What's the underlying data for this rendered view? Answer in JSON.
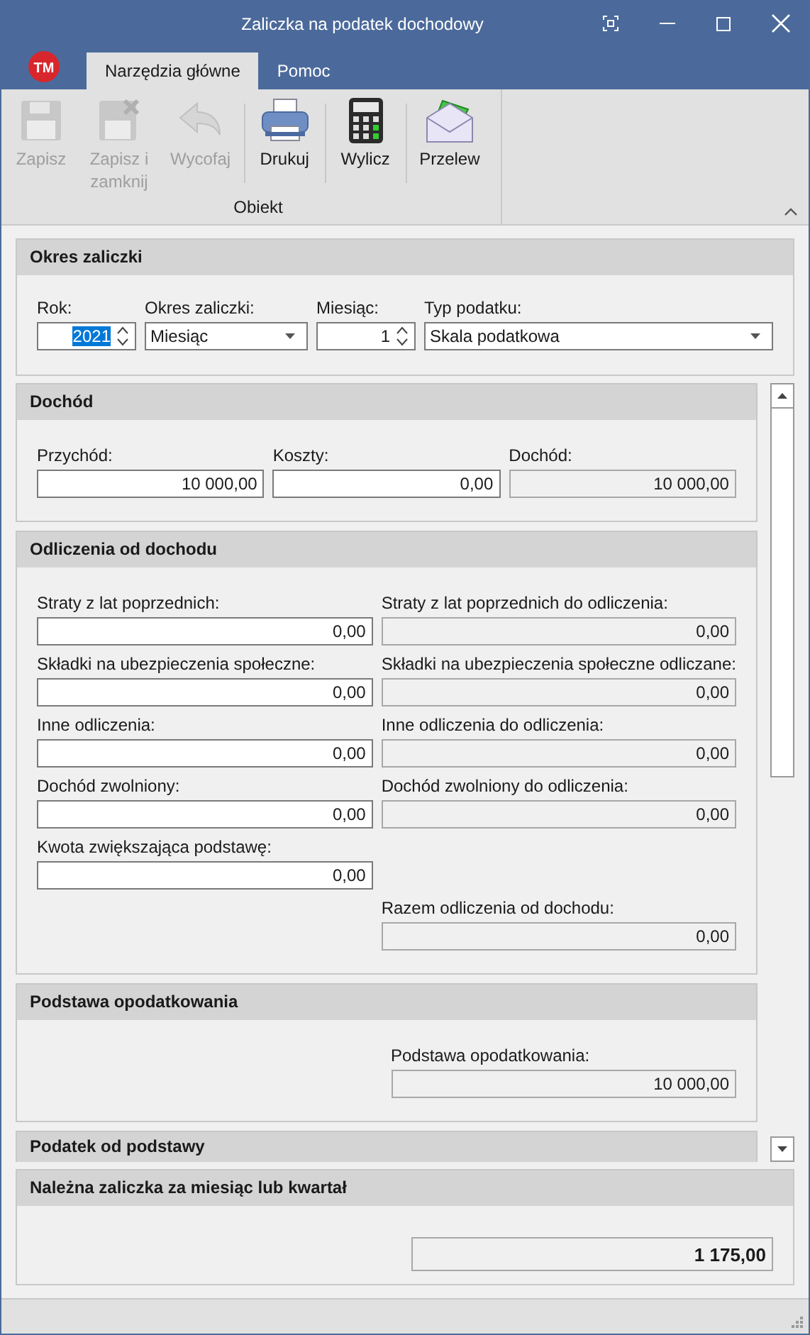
{
  "window": {
    "title": "Zaliczka na podatek dochodowy"
  },
  "ribbon": {
    "logo": "TM",
    "tabs": [
      {
        "label": "Narzędzia główne",
        "selected": true
      },
      {
        "label": "Pomoc",
        "selected": false
      }
    ],
    "buttons": [
      {
        "label": "Zapisz",
        "kind": "floppy",
        "disabled": true,
        "separated": false
      },
      {
        "label": "Zapisz i zamknij",
        "kind": "floppy-x",
        "disabled": true,
        "separated": false
      },
      {
        "label": "Wycofaj",
        "kind": "undo",
        "disabled": true,
        "separated": false
      },
      {
        "label": "Drukuj",
        "kind": "printer",
        "disabled": false,
        "separated": true
      },
      {
        "label": "Wylicz",
        "kind": "calculator",
        "disabled": false,
        "separated": true
      },
      {
        "label": "Przelew",
        "kind": "envelope",
        "disabled": false,
        "separated": true
      }
    ],
    "group": "Obiekt"
  },
  "sections": [
    {
      "title": "Okres zaliczki",
      "rows": [
        [
          {
            "label": "Rok:",
            "value": "2021",
            "kind": "spin",
            "selected": true
          },
          {
            "label": "Okres zaliczki:",
            "value": "Miesiąc",
            "kind": "combo",
            "selected": false
          },
          {
            "label": "Miesiąc:",
            "value": "1",
            "kind": "spin",
            "selected": false
          },
          {
            "label": "Typ podatku:",
            "value": "Skala podatkowa",
            "kind": "combo",
            "selected": false
          }
        ]
      ]
    }
  ],
  "scroll_sections": [
    {
      "title": "Dochód",
      "rows": [
        [
          {
            "label": "Przychód:",
            "value": "10 000,00",
            "kind": "input"
          },
          {
            "label": "Koszty:",
            "value": "0,00",
            "kind": "input"
          },
          {
            "label": "Dochód:",
            "value": "10 000,00",
            "kind": "readonly"
          }
        ]
      ]
    },
    {
      "title": "Odliczenia od dochodu",
      "rows": [
        [
          {
            "label": "Straty z lat poprzednich:",
            "value": "0,00",
            "kind": "input"
          },
          {
            "label": "Straty z lat poprzednich do odliczenia:",
            "value": "0,00",
            "kind": "readonly"
          }
        ],
        [
          {
            "label": "Składki na ubezpieczenia społeczne:",
            "value": "0,00",
            "kind": "input"
          },
          {
            "label": "Składki na ubezpieczenia społeczne odliczane:",
            "value": "0,00",
            "kind": "readonly"
          }
        ],
        [
          {
            "label": "Inne odliczenia:",
            "value": "0,00",
            "kind": "input"
          },
          {
            "label": "Inne odliczenia do odliczenia:",
            "value": "0,00",
            "kind": "readonly"
          }
        ],
        [
          {
            "label": "Dochód zwolniony:",
            "value": "0,00",
            "kind": "input"
          },
          {
            "label": "Dochód zwolniony do odliczenia:",
            "value": "0,00",
            "kind": "readonly"
          }
        ],
        [
          {
            "label": "Kwota zwiększająca podstawę:",
            "value": "0,00",
            "kind": "input"
          },
          null
        ],
        [
          null,
          {
            "label": "Razem odliczenia od dochodu:",
            "value": "0,00",
            "kind": "readonly"
          }
        ]
      ]
    },
    {
      "title": "Podstawa opodatkowania",
      "rows": [
        [
          null,
          {
            "label": "Podstawa opodatkowania:",
            "value": "10 000,00",
            "kind": "readonly"
          }
        ]
      ]
    },
    {
      "title": "Podatek od podstawy"
    }
  ],
  "total_section": {
    "title": "Należna zaliczka za miesiąc lub kwartał",
    "rows": [
      [
        null,
        {
          "value": "1 175,00",
          "kind": "total"
        }
      ]
    ]
  }
}
